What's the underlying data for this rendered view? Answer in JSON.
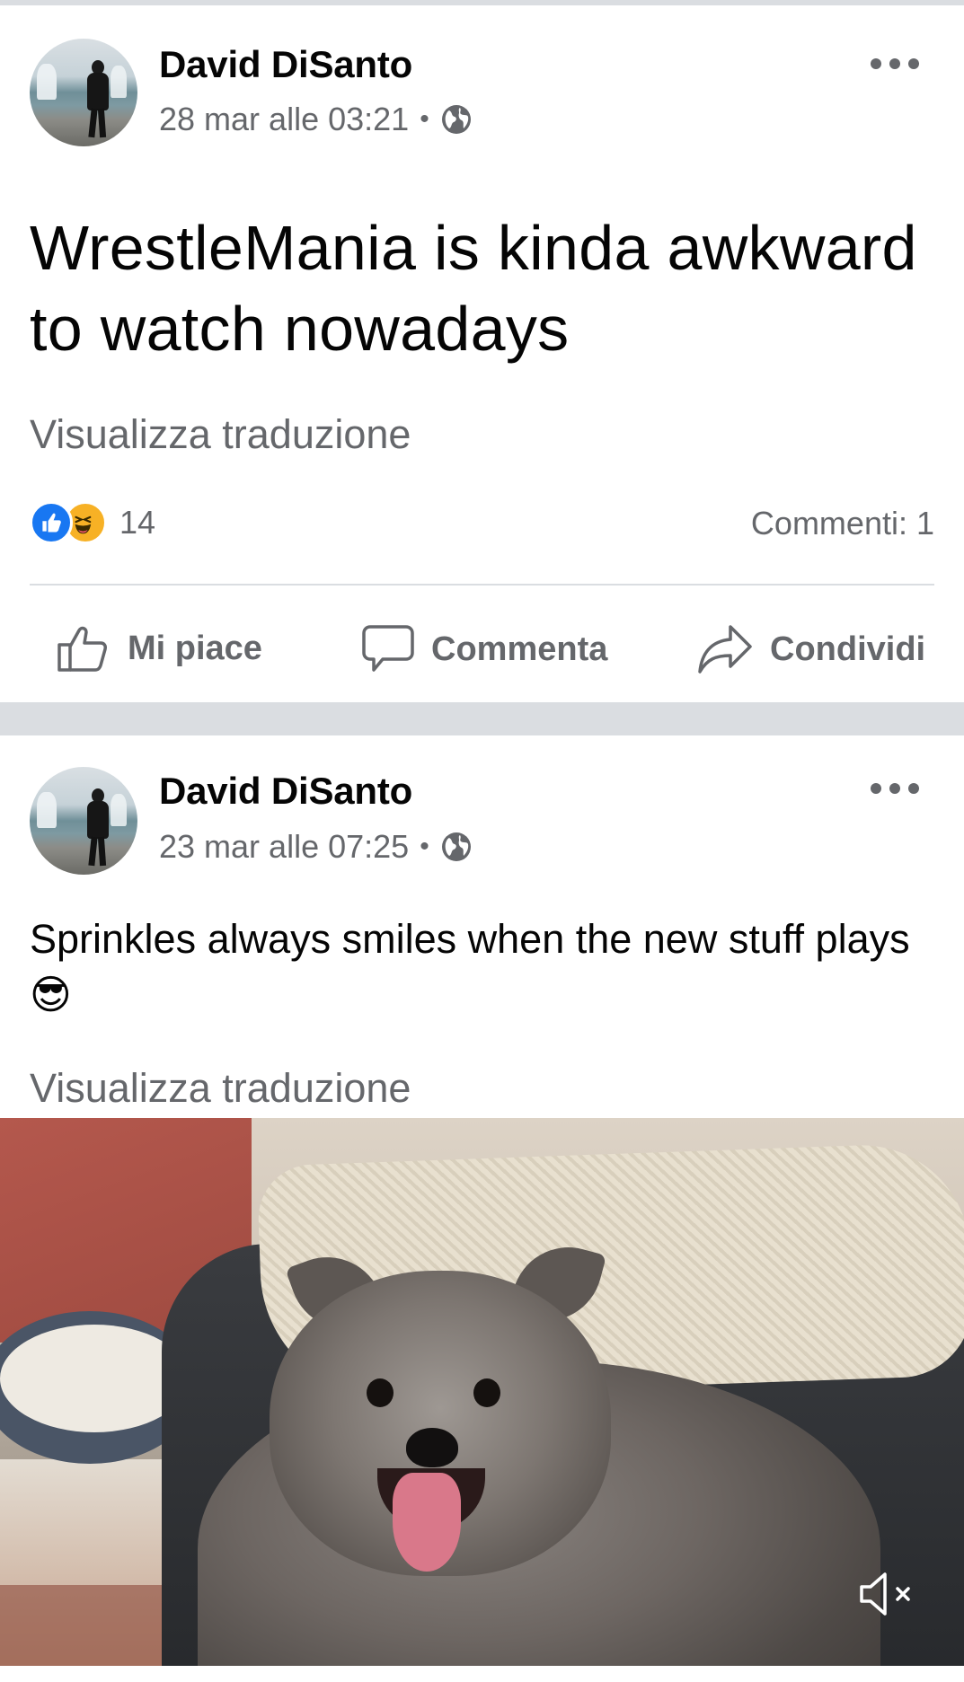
{
  "posts": [
    {
      "author": "David DiSanto",
      "timestamp": "28 mar alle 03:21",
      "separator": "•",
      "privacy_icon": "globe-icon",
      "text": "WrestleMania is kinda awkward to watch nowadays",
      "see_translation": "Visualizza traduzione",
      "reactions": {
        "icons": [
          "like-icon",
          "haha-icon"
        ],
        "count": "14"
      },
      "comments": "Commenti: 1",
      "actions": {
        "like": "Mi piace",
        "comment": "Commenta",
        "share": "Condividi"
      }
    },
    {
      "author": "David DiSanto",
      "timestamp": "23 mar alle 07:25",
      "separator": "•",
      "privacy_icon": "globe-icon",
      "text": "Sprinkles always smiles when the new stuff plays 😎",
      "see_translation": "Visualizza traduzione",
      "video": {
        "muted": true,
        "mute_icon": "speaker-muted-icon"
      }
    }
  ],
  "colors": {
    "primary_text": "#050505",
    "secondary_text": "#65676b",
    "divider": "#dadde1",
    "like_blue": "#1877f2",
    "haha_yellow": "#f7b125"
  }
}
